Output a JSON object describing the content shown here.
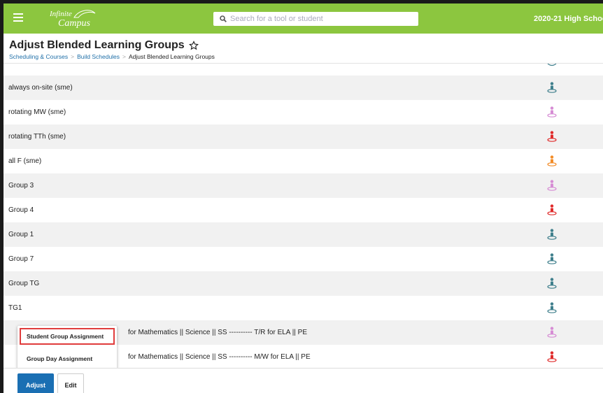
{
  "topbar": {
    "logo_line1": "Infinite",
    "logo_line2": "Campus",
    "search_placeholder": "Search for a tool or student",
    "year_selector": "2020-21 High Schoo"
  },
  "header": {
    "title": "Adjust Blended Learning Groups",
    "breadcrumb": [
      {
        "label": "Scheduling & Courses"
      },
      {
        "label": "Build Schedules"
      },
      {
        "label": "Adjust Blended Learning Groups"
      }
    ],
    "breadcrumb_separator": ">"
  },
  "groups": [
    {
      "name": "always on-site (sme)",
      "icon_color": "#3f7f8c"
    },
    {
      "name": "rotating MW (sme)",
      "icon_color": "#d68cd4"
    },
    {
      "name": "rotating TTh (sme)",
      "icon_color": "#e02b2b"
    },
    {
      "name": "all F (sme)",
      "icon_color": "#f28c28"
    },
    {
      "name": "Group 3",
      "icon_color": "#d68cd4"
    },
    {
      "name": "Group 4",
      "icon_color": "#e02b2b"
    },
    {
      "name": "Group 1",
      "icon_color": "#3f7f8c"
    },
    {
      "name": "Group 7",
      "icon_color": "#3f7f8c"
    },
    {
      "name": "Group TG",
      "icon_color": "#3f7f8c"
    },
    {
      "name": "TG1",
      "icon_color": "#3f7f8c"
    },
    {
      "name": "for Mathematics || Science || SS ---------- T/R for ELA || PE",
      "icon_color": "#d68cd4"
    },
    {
      "name": "for Mathematics || Science || SS ---------- M/W for ELA || PE",
      "icon_color": "#e02b2b"
    }
  ],
  "menu": {
    "student_group_assignment": "Student Group Assignment",
    "group_day_assignment": "Group Day Assignment"
  },
  "footer": {
    "adjust_label": "Adjust",
    "edit_label": "Edit"
  },
  "colors": {
    "topbar": "#8cc63f",
    "primary_button": "#1a6fb3",
    "link": "#1f6fa8",
    "highlight_border": "#e03c3c"
  }
}
